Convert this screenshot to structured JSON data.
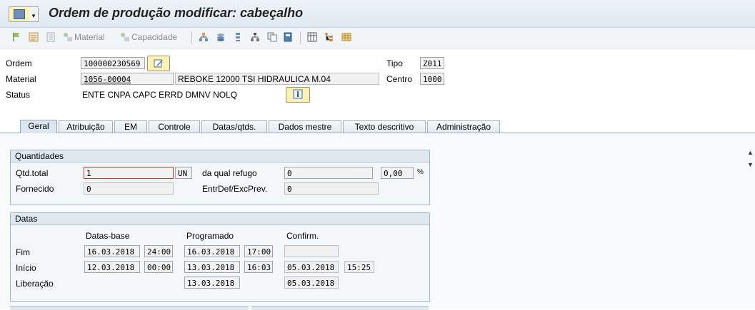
{
  "window": {
    "title": "Ordem de produção modificar: cabeçalho"
  },
  "toolbar": {
    "material_label": "Material",
    "capacidade_label": "Capacidade",
    "icons": [
      "flag-icon",
      "checklist-icon",
      "document-icon",
      "material-icon",
      "capacity-icon",
      "hierarchy-icon",
      "stack-icon",
      "list-icon",
      "tree-icon",
      "copy-icon",
      "save-icon",
      "grid-icon",
      "tree-colored-icon",
      "table-icon"
    ]
  },
  "header": {
    "ordem_label": "Ordem",
    "ordem_value": "100000230569",
    "material_label": "Material",
    "material_value": "1056-00004",
    "material_desc": "REBOKE 12000 TSI HIDRAULICA M.04",
    "status_label": "Status",
    "status_value": "ENTE CNPA CAPC ERRD DMNV NOLQ",
    "tipo_label": "Tipo",
    "tipo_value": "Z011",
    "centro_label": "Centro",
    "centro_value": "1000"
  },
  "tabs": [
    {
      "label": "Geral",
      "active": true
    },
    {
      "label": "Atribuição"
    },
    {
      "label": "EM"
    },
    {
      "label": "Controle"
    },
    {
      "label": "Datas/qtds."
    },
    {
      "label": "Dados mestre"
    },
    {
      "label": "Texto descritivo"
    },
    {
      "label": "Administração"
    }
  ],
  "quantidades": {
    "title": "Quantidades",
    "qtd_total_label": "Qtd.total",
    "qtd_total_value": "1",
    "unit": "UN",
    "refugo_label": "da qual refugo",
    "refugo_value": "0",
    "refugo_pct": "0,00",
    "pct_sign": "%",
    "fornecido_label": "Fornecido",
    "fornecido_value": "0",
    "entrdef_label": "EntrDef/ExcPrev.",
    "entrdef_value": "0"
  },
  "datas": {
    "title": "Datas",
    "col_base": "Datas-base",
    "col_prog": "Programado",
    "col_conf": "Confirm.",
    "fim_label": "Fim",
    "inicio_label": "Início",
    "liberacao_label": "Liberação",
    "fim_base_date": "16.03.2018",
    "fim_base_time": "24:00",
    "fim_prog_date": "16.03.2018",
    "fim_prog_time": "17:00",
    "fim_conf_date": "",
    "ini_base_date": "12.03.2018",
    "ini_base_time": "00:00",
    "ini_prog_date": "13.03.2018",
    "ini_prog_time": "16:03",
    "ini_conf_date": "05.03.2018",
    "ini_conf_time": "15:25",
    "lib_prog_date": "13.03.2018",
    "lib_conf_date": "05.03.2018"
  }
}
